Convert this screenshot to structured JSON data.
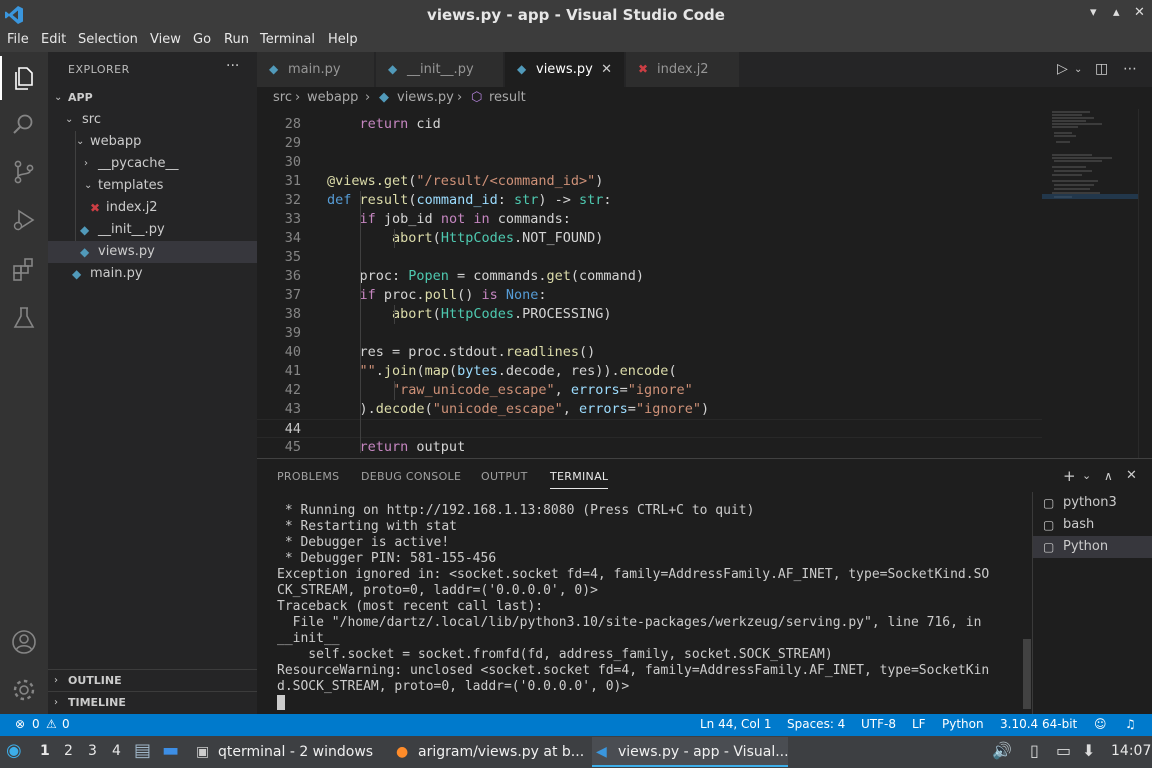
{
  "window": {
    "title": "views.py - app - Visual Studio Code",
    "controls": [
      "▾",
      "▴",
      "✕"
    ]
  },
  "menu": [
    "File",
    "Edit",
    "Selection",
    "View",
    "Go",
    "Run",
    "Terminal",
    "Help"
  ],
  "activity_bar": {
    "icons": [
      "files-icon",
      "search-icon",
      "source-control-icon",
      "run-debug-icon",
      "extensions-icon",
      "testing-icon",
      "account-icon",
      "settings-gear-icon"
    ]
  },
  "explorer": {
    "header": "EXPLORER",
    "more": "···",
    "root": "APP",
    "items": [
      {
        "label": "src",
        "kind": "folder",
        "open": true
      },
      {
        "label": "webapp",
        "kind": "folder",
        "open": true
      },
      {
        "label": "__pycache__",
        "kind": "folder",
        "open": false
      },
      {
        "label": "templates",
        "kind": "folder",
        "open": true
      },
      {
        "label": "index.j2",
        "kind": "jinja"
      },
      {
        "label": "__init__.py",
        "kind": "python"
      },
      {
        "label": "views.py",
        "kind": "python",
        "selected": true
      },
      {
        "label": "main.py",
        "kind": "python"
      }
    ],
    "outline": "OUTLINE",
    "timeline": "TIMELINE"
  },
  "tabs": [
    {
      "label": "main.py",
      "icon": "python-file-icon",
      "active": false
    },
    {
      "label": "__init__.py",
      "icon": "python-file-icon",
      "active": false
    },
    {
      "label": "views.py",
      "icon": "python-file-icon",
      "active": true,
      "close": "✕"
    },
    {
      "label": "index.j2",
      "icon": "jinja-file-icon",
      "active": false
    }
  ],
  "breadcrumb": [
    "src",
    "webapp",
    "views.py",
    "result"
  ],
  "editor": {
    "current_line": 44,
    "lines": [
      {
        "n": "28",
        "text": "    return cid"
      },
      {
        "n": "29",
        "text": ""
      },
      {
        "n": "30",
        "text": ""
      },
      {
        "n": "31",
        "text": "@views.get(\"/result/<command_id>\")"
      },
      {
        "n": "32",
        "text": "def result(command_id: str) -> str:"
      },
      {
        "n": "33",
        "text": "    if job_id not in commands:"
      },
      {
        "n": "34",
        "text": "        abort(HttpCodes.NOT_FOUND)"
      },
      {
        "n": "35",
        "text": ""
      },
      {
        "n": "36",
        "text": "    proc: Popen = commands.get(command)"
      },
      {
        "n": "37",
        "text": "    if proc.poll() is None:"
      },
      {
        "n": "38",
        "text": "        abort(HttpCodes.PROCESSING)"
      },
      {
        "n": "39",
        "text": ""
      },
      {
        "n": "40",
        "text": "    res = proc.stdout.readlines()"
      },
      {
        "n": "41",
        "text": "    \"\".join(map(bytes.decode, res)).encode("
      },
      {
        "n": "42",
        "text": "        \"raw_unicode_escape\", errors=\"ignore\""
      },
      {
        "n": "43",
        "text": "    ).decode(\"unicode_escape\", errors=\"ignore\")"
      },
      {
        "n": "44",
        "text": ""
      },
      {
        "n": "45",
        "text": "    return output"
      }
    ]
  },
  "panel": {
    "tabs": [
      "PROBLEMS",
      "DEBUG CONSOLE",
      "OUTPUT",
      "TERMINAL"
    ],
    "active_tab": "TERMINAL",
    "actions": [
      "+",
      "⌄",
      "∧",
      "✕"
    ],
    "terminal_lines": [
      " * Running on http://192.168.1.13:8080 (Press CTRL+C to quit)",
      " * Restarting with stat",
      " * Debugger is active!",
      " * Debugger PIN: 581-155-456",
      "Exception ignored in: <socket.socket fd=4, family=AddressFamily.AF_INET, type=SocketKind.SO",
      "CK_STREAM, proto=0, laddr=('0.0.0.0', 0)>",
      "Traceback (most recent call last):",
      "  File \"/home/dartz/.local/lib/python3.10/site-packages/werkzeug/serving.py\", line 716, in",
      "__init__",
      "    self.socket = socket.fromfd(fd, address_family, socket.SOCK_STREAM)",
      "ResourceWarning: unclosed <socket.socket fd=4, family=AddressFamily.AF_INET, type=SocketKin",
      "d.SOCK_STREAM, proto=0, laddr=('0.0.0.0', 0)>"
    ],
    "terminals": [
      {
        "label": "python3",
        "selected": false
      },
      {
        "label": "bash",
        "selected": false
      },
      {
        "label": "Python",
        "selected": true
      }
    ]
  },
  "status": {
    "errors": "0",
    "warnings": "0",
    "position": "Ln 44, Col 1",
    "spaces": "Spaces: 4",
    "encoding": "UTF-8",
    "eol": "LF",
    "language": "Python",
    "interpreter": "3.10.4 64-bit"
  },
  "taskbar": {
    "desktops": [
      "1",
      "2",
      "3",
      "4"
    ],
    "windows": [
      {
        "label": "qterminal - 2 windows",
        "active": false
      },
      {
        "label": "arigram/views.py at b...",
        "active": false
      },
      {
        "label": "views.py - app - Visual...",
        "active": true
      }
    ],
    "clock": "14:07"
  },
  "colors": {
    "accent": "#007acc",
    "python_icon": "#519aba",
    "jinja_icon": "#cc3e44"
  }
}
